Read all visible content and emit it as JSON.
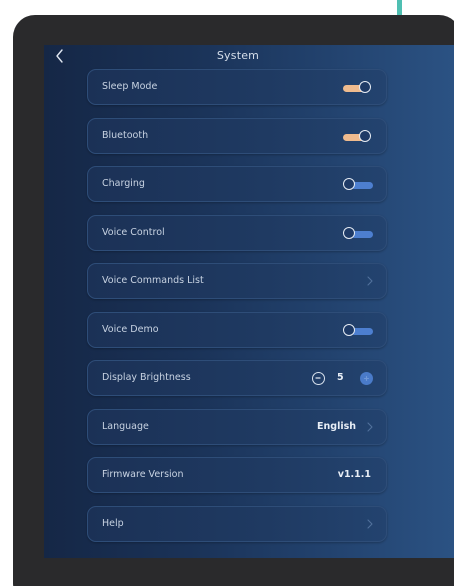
{
  "header": {
    "title": "System"
  },
  "rows": {
    "sleep_mode": {
      "label": "Sleep Mode",
      "on": true
    },
    "bluetooth": {
      "label": "Bluetooth",
      "on": true
    },
    "charging": {
      "label": "Charging",
      "on": false
    },
    "voice_control": {
      "label": "Voice Control",
      "on": false
    },
    "voice_commands_list": {
      "label": "Voice Commands List"
    },
    "voice_demo": {
      "label": "Voice Demo",
      "on": false
    },
    "display_brightness": {
      "label": "Display Brightness",
      "value": "5"
    },
    "language": {
      "label": "Language",
      "value": "English"
    },
    "firmware_version": {
      "label": "Firmware Version",
      "value": "v1.1.1"
    },
    "help": {
      "label": "Help"
    }
  },
  "icons": {
    "back": "chevron-left-icon",
    "row_arrow": "chevron-right-icon",
    "minus": "minus-circle-icon",
    "plus": "plus-circle-icon"
  },
  "colors": {
    "indicator": "#5cc7b9",
    "toggle_on_track": "#efbb8e",
    "toggle_off_track": "#4d7fd0",
    "stepper_plus": "#4a7bc9",
    "bezel": "#2a2a2c"
  }
}
